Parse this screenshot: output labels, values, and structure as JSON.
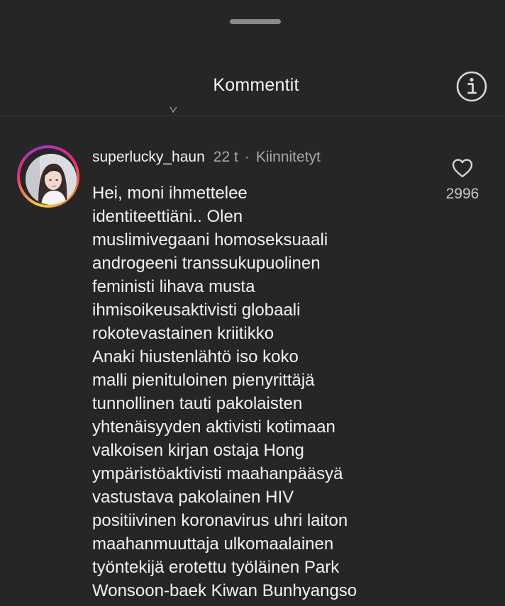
{
  "header": {
    "title": "Kommentit",
    "info_icon": "info-circle-icon"
  },
  "comment": {
    "username": "superlucky_haun",
    "time": "22 t",
    "separator": "·",
    "pinned_label": "Kiinnitetyt",
    "like_icon": "heart-outline-icon",
    "like_count": "2996",
    "lines": [
      "Hei, moni ihmettelee",
      "identiteettiäni.. Olen",
      "muslimivegaani homoseksuaali",
      "androgeeni transsukupuolinen",
      "feministi lihava musta",
      "ihmisoikeusaktivisti globaali",
      "rokotevastainen kriitikko",
      "Anaki hiustenlähtö iso koko",
      "malli pienituloinen pienyrittäjä",
      "tunnollinen tauti pakolaisten",
      "yhtenäisyyden aktivisti kotimaan",
      "valkoisen kirjan ostaja Hong",
      "ympäristöaktivisti maahanpääsyä",
      "vastustava pakolainen HIV",
      "positiivinen koronavirus uhri laiton",
      "maahanmuuttaja ulkomaalainen",
      "työntekijä erotettu työläinen Park",
      "Wonsoon-baek Kiwan Bunhyangso"
    ]
  },
  "colors": {
    "background": "#262626",
    "text_primary": "#f3f3f3",
    "text_secondary": "#a8a8a8",
    "handle": "#8a8a8a"
  }
}
